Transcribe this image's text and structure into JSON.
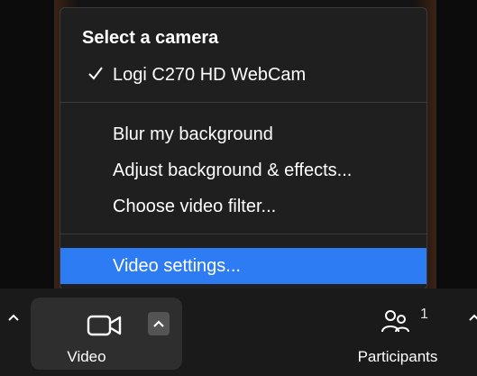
{
  "menu": {
    "header": "Select a camera",
    "camera_option": {
      "label": "Logi C270 HD WebCam",
      "checked": true
    },
    "items": [
      {
        "label": "Blur my background"
      },
      {
        "label": "Adjust background & effects..."
      },
      {
        "label": "Choose video filter..."
      }
    ],
    "settings": {
      "label": "Video settings...",
      "highlighted": true
    }
  },
  "toolbar": {
    "video": {
      "label": "Video",
      "icon": "video-camera-icon"
    },
    "video_options_icon": "chevron-up-icon",
    "participants": {
      "label": "Participants",
      "count": "1",
      "icon": "participants-icon"
    }
  },
  "colors": {
    "menu_bg": "#1f1f1f",
    "highlight": "#2d7cf3",
    "toolbar_bg": "#1a1a1a",
    "button_bg": "#2e2e2e"
  }
}
